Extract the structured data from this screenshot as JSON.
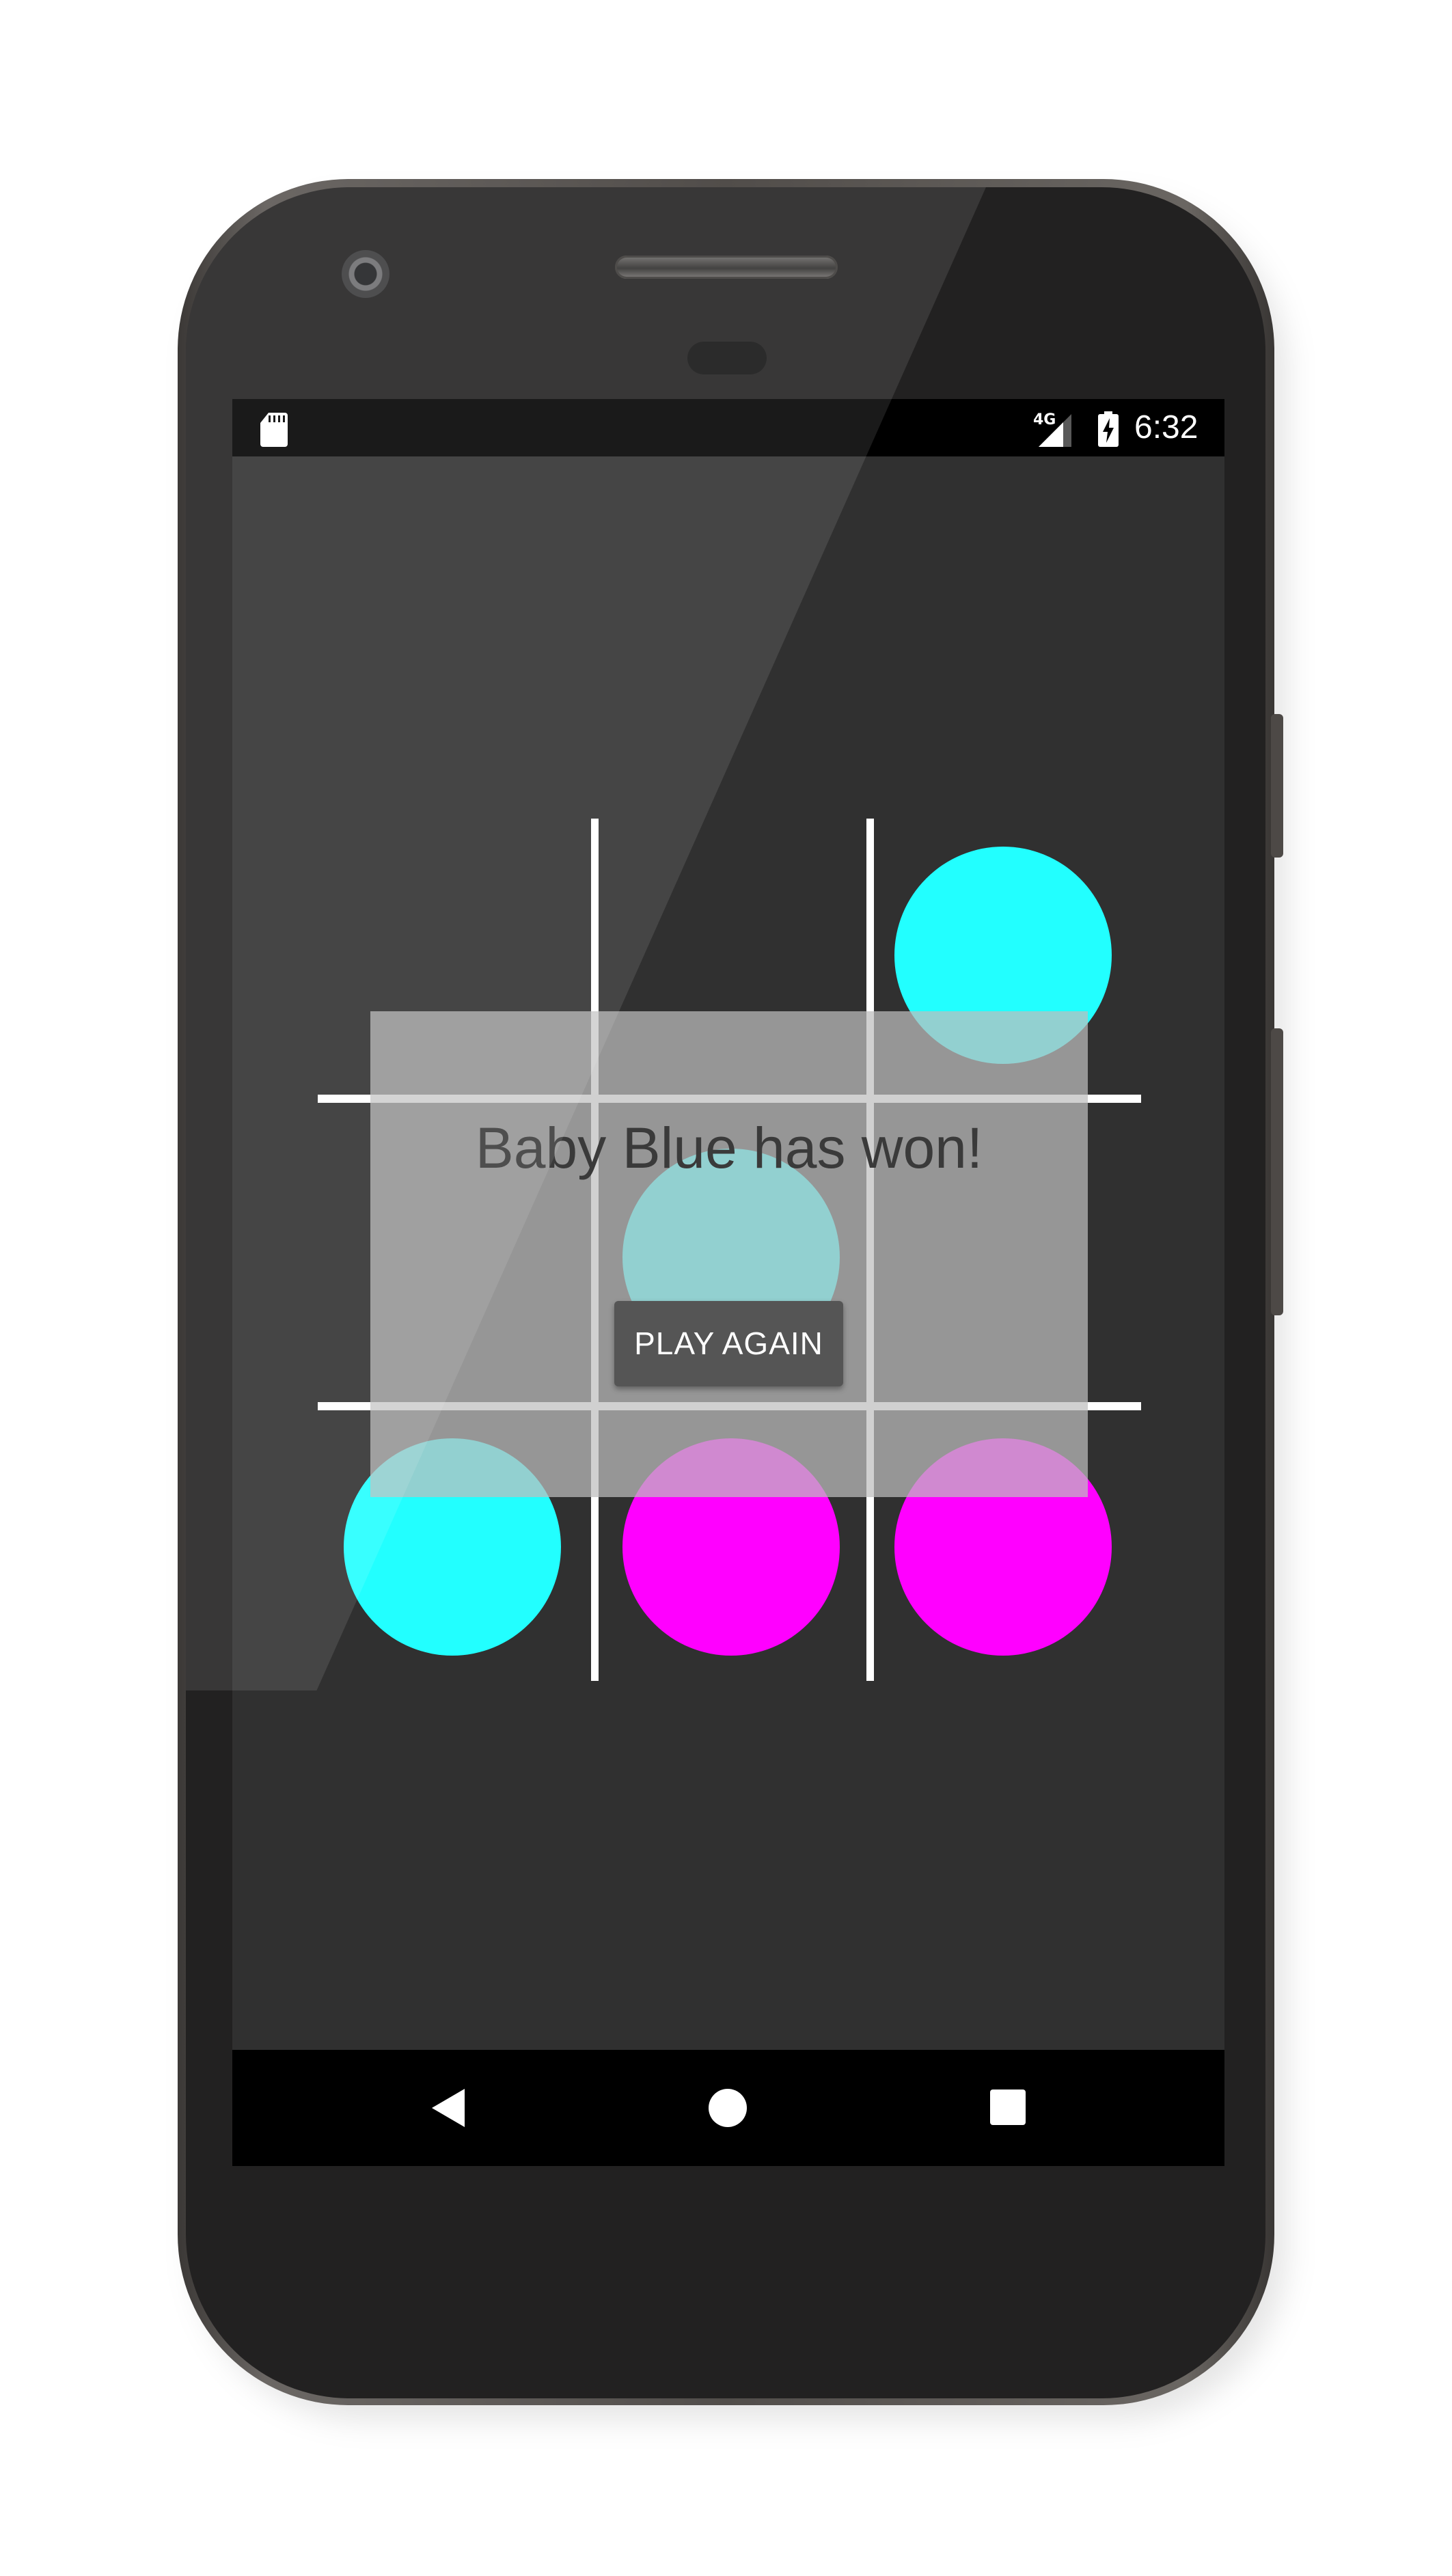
{
  "status_bar": {
    "network": "4G",
    "time": "6:32",
    "icons": [
      "sd-card-icon",
      "cell-signal-icon",
      "battery-charging-icon"
    ]
  },
  "game": {
    "player_colors": {
      "baby_blue": "#22FFFF",
      "magenta": "#FF00FF"
    },
    "board": [
      [
        "",
        "",
        "baby_blue"
      ],
      [
        "",
        "baby_blue",
        ""
      ],
      [
        "baby_blue",
        "magenta",
        "magenta"
      ]
    ],
    "line_color": "#FFFFFF",
    "background_color": "#303030"
  },
  "winner_dialog": {
    "message": "Baby Blue has won!",
    "button_label": "PLAY AGAIN"
  },
  "nav_bar": {
    "icons": [
      "back-icon",
      "home-icon",
      "recents-icon"
    ]
  }
}
